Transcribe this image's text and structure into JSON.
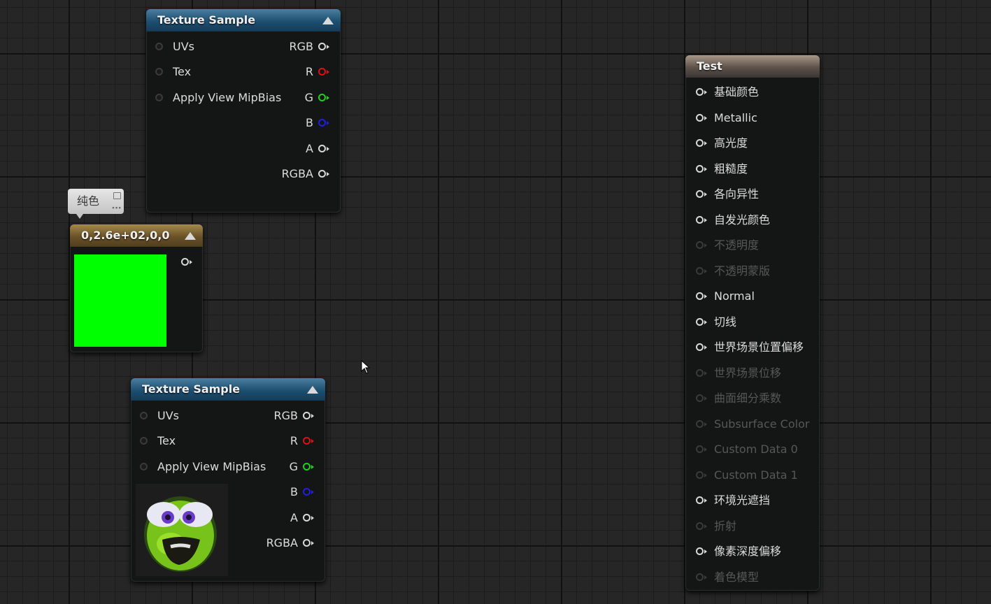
{
  "texture_sample_top": {
    "title": "Texture Sample",
    "inputs": [
      "UVs",
      "Tex",
      "Apply View MipBias"
    ],
    "outputs": [
      "RGB",
      "R",
      "G",
      "B",
      "A",
      "RGBA"
    ]
  },
  "texture_sample_bottom": {
    "title": "Texture Sample",
    "inputs": [
      "UVs",
      "Tex",
      "Apply View MipBias"
    ],
    "outputs": [
      "RGB",
      "R",
      "G",
      "B",
      "A",
      "RGBA"
    ]
  },
  "comment_bubble": {
    "text": "纯色"
  },
  "constant_node": {
    "title": "0,2.6e+02,0,0",
    "swatch_color": "#00ff00"
  },
  "test_node": {
    "title": "Test",
    "inputs": [
      {
        "label": "基础颜色",
        "enabled": true
      },
      {
        "label": "Metallic",
        "enabled": true
      },
      {
        "label": "高光度",
        "enabled": true
      },
      {
        "label": "粗糙度",
        "enabled": true
      },
      {
        "label": "各向异性",
        "enabled": true
      },
      {
        "label": "自发光颜色",
        "enabled": true
      },
      {
        "label": "不透明度",
        "enabled": false
      },
      {
        "label": "不透明蒙版",
        "enabled": false
      },
      {
        "label": "Normal",
        "enabled": true
      },
      {
        "label": "切线",
        "enabled": true
      },
      {
        "label": "世界场景位置偏移",
        "enabled": true
      },
      {
        "label": "世界场景位移",
        "enabled": false
      },
      {
        "label": "曲面细分乘数",
        "enabled": false
      },
      {
        "label": "Subsurface Color",
        "enabled": false
      },
      {
        "label": "Custom Data 0",
        "enabled": false
      },
      {
        "label": "Custom Data 1",
        "enabled": false
      },
      {
        "label": "环境光遮挡",
        "enabled": true
      },
      {
        "label": "折射",
        "enabled": false
      },
      {
        "label": "像素深度偏移",
        "enabled": true
      },
      {
        "label": "着色模型",
        "enabled": false
      }
    ]
  },
  "colors": {
    "tex_header": "#1d4f70",
    "const_header": "#6a5227",
    "test_header": "#5c524a",
    "pin_r": "#e01010",
    "pin_g": "#19d419",
    "pin_b": "#2020e0"
  },
  "icons": [
    "collapse-arrow-icon",
    "pin-icon",
    "mouse-cursor-icon",
    "texture-thumbnail-icon"
  ]
}
